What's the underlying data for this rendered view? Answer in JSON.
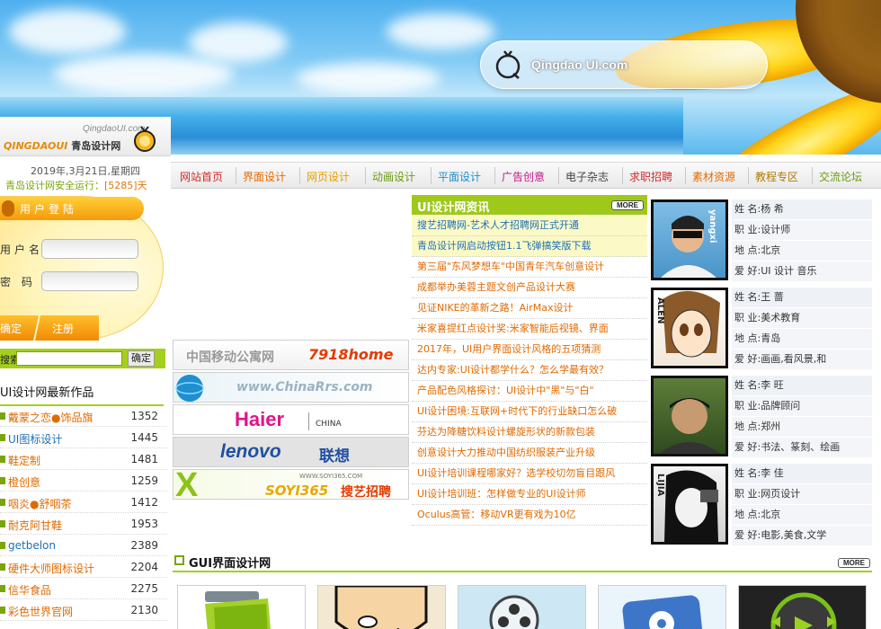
{
  "banner": {
    "logo_text": "Qingdao UI.com",
    "icon": "orange-logo-icon"
  },
  "header": {
    "site_domain": "QingdaoUI.com",
    "brand_en": "QINGDAOUI",
    "brand_cn": "青岛设计网",
    "date": "2019年,3月21日,星期四",
    "safe_prefix": "青岛设计网安全运行：",
    "safe_days": "[5285]天"
  },
  "login": {
    "title": "用户登陆",
    "username_label": "用户名",
    "password_label": "密 码",
    "login_btn": "确定",
    "register_btn": "注册"
  },
  "search": {
    "label": "搜索",
    "button": "确定"
  },
  "works": {
    "title": "UI设计网最新作品",
    "items": [
      {
        "name": "戴蒙之恋●饰品旗",
        "count": "1352"
      },
      {
        "name": "UI图标设计",
        "count": "1445"
      },
      {
        "name": "鞋定制",
        "count": "1481"
      },
      {
        "name": "橙创意",
        "count": "1259"
      },
      {
        "name": "咽炎●舒咽茶",
        "count": "1412"
      },
      {
        "name": "耐克阿甘鞋",
        "count": "1953"
      },
      {
        "name": "getbelon",
        "count": "2389"
      },
      {
        "name": "硬件大师图标设计",
        "count": "2204"
      },
      {
        "name": "信华食品",
        "count": "2275"
      },
      {
        "name": "彩色世界官网",
        "count": "2130"
      }
    ]
  },
  "nav": {
    "items": [
      {
        "label": "网站首页",
        "color": "#d12a2a"
      },
      {
        "label": "界面设计",
        "color": "#e56a00"
      },
      {
        "label": "网页设计",
        "color": "#e2a000"
      },
      {
        "label": "动画设计",
        "color": "#6a9a12"
      },
      {
        "label": "平面设计",
        "color": "#1d8ed0"
      },
      {
        "label": "广告创意",
        "color": "#c1178a"
      },
      {
        "label": "电子杂志",
        "color": "#444444"
      },
      {
        "label": "求职招聘",
        "color": "#d12a2a"
      },
      {
        "label": "素材资源",
        "color": "#e56a00"
      },
      {
        "label": "教程专区",
        "color": "#b07a00"
      },
      {
        "label": "交流论坛",
        "color": "#6a9a12"
      }
    ]
  },
  "ads": [
    {
      "name": "中国移动公寓网",
      "extra": "7918home"
    },
    {
      "name": "www.ChinaRrs.com"
    },
    {
      "name": "Haier",
      "extra": "CHINA"
    },
    {
      "name": "lenovo",
      "extra": "联想"
    },
    {
      "name": "SOYI365",
      "extra": "搜艺招聘",
      "small": "WWW.SOYI365.COM"
    }
  ],
  "news": {
    "title": "UI设计网资讯",
    "more": "MORE",
    "items": [
      "搜艺招聘网-艺术人才招聘网正式开通",
      "青岛设计网启动按钮1.1飞弹搞笑版下载",
      "第三届\"东风梦想车\"中国青年汽车创意设计",
      "成都举办美蓉主题文创产品设计大赛",
      "见证NIKE的革新之路！AirMax设计",
      "米家喜提红点设计奖:米家智能后视镜、界面",
      "2017年，UI用户界面设计风格的五项猜测",
      "达内专家:UI设计都学什么？怎么学最有效？",
      "产品配色风格探讨：UI设计中\"黑\"与\"白\"",
      "UI设计困境:互联网+时代下的行业缺口怎么破",
      "芬达为降糖饮料设计螺旋形状的新款包装",
      "创意设计大力推动中国纺织服装产业升级",
      "UI设计培训课程哪家好？选学校切勿盲目跟风",
      "UI设计培训班：怎样做专业的UI设计师",
      "Oculus高管：移动VR更有戏为10亿"
    ]
  },
  "profiles": [
    {
      "name": "姓 名:杨 希",
      "job": "职 业:设计师",
      "place": "地 点:北京",
      "hobby": "爱 好:UI 设计 音乐",
      "tag": "yangxi"
    },
    {
      "name": "姓 名:王 蔷",
      "job": "职 业:美术教育",
      "place": "地 点:青岛",
      "hobby": "爱 好:画画,看风景,和",
      "tag": "ALEN"
    },
    {
      "name": "姓 名:李 旺",
      "job": "职 业:品牌顾问",
      "place": "地 点:郑州",
      "hobby": "爱 好:书法、篆刻、绘画",
      "tag": ""
    },
    {
      "name": "姓 名:李 佳",
      "job": "职 业:网页设计",
      "place": "地 点:北京",
      "hobby": "爱 好:电影,美食,文学",
      "tag": "LIJIA"
    }
  ],
  "gui": {
    "title": "GUI界面设计网",
    "more": "MORE"
  }
}
